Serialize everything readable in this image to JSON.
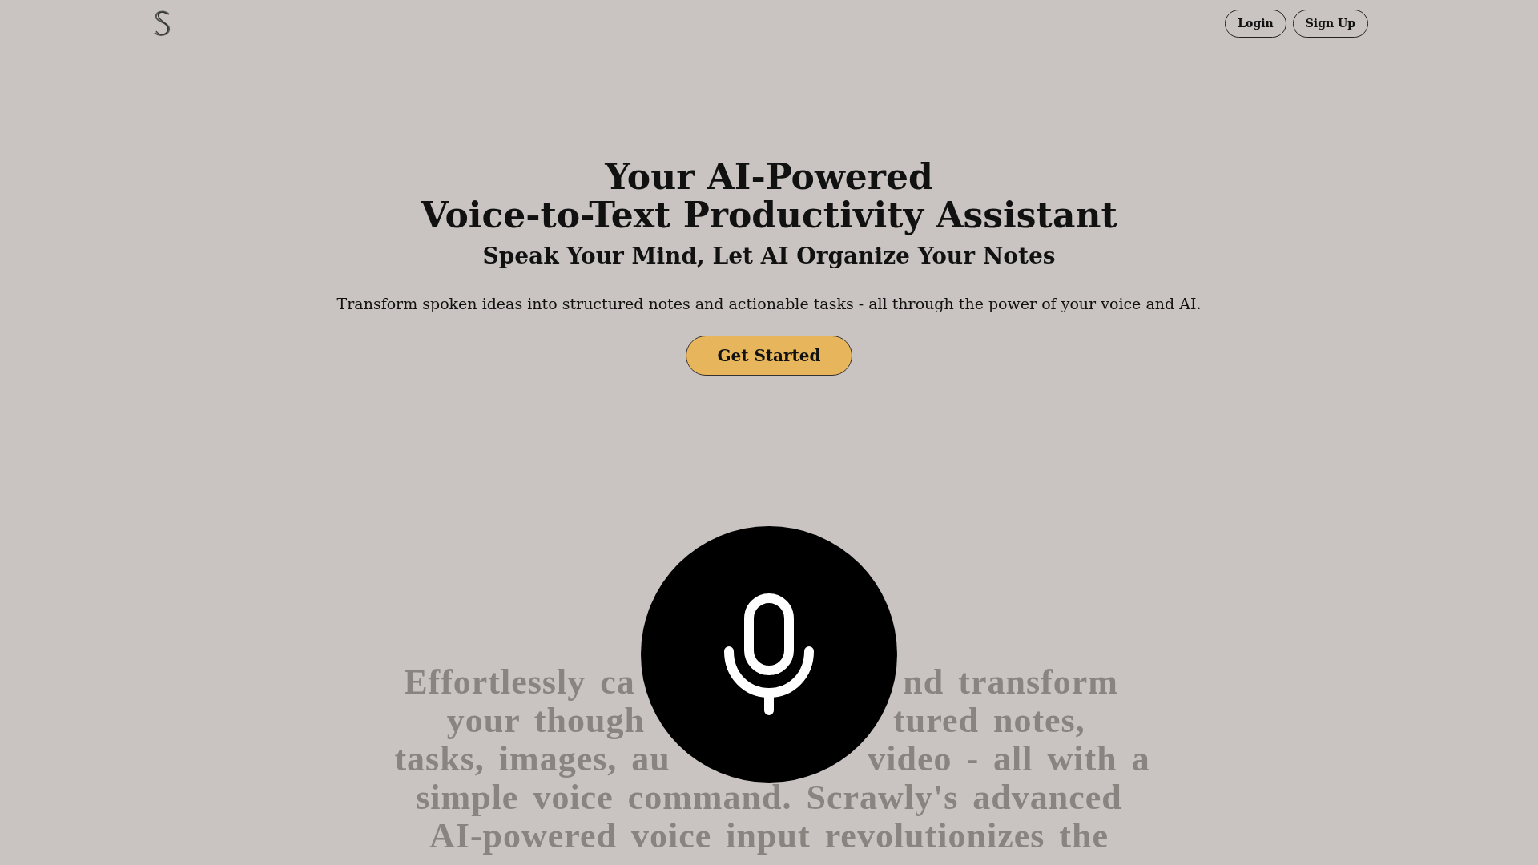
{
  "nav": {
    "buttons": [
      "Login",
      "Sign Up"
    ]
  },
  "hero": {
    "title_lines": [
      "Your AI-Powered",
      "Voice-to-Text Productivity Assistant"
    ],
    "subtitle": "Speak Your Mind, Let AI Organize Your Notes",
    "description": "Transform spoken ideas into structured notes and actionable tasks - all through the power of your voice and AI.",
    "cta": "Get Started"
  },
  "background_text": {
    "lines": [
      {
        "left": "Effortlessly ca",
        "right": "nd transform"
      },
      {
        "left": "your though",
        "right": "tured notes,"
      },
      {
        "left": "tasks, images, au",
        "right": "video - all with a"
      },
      {
        "left": "simple voice command. Scrawly's advanced"
      },
      {
        "left": "AI-powered voice input revolutionizes the"
      }
    ]
  }
}
